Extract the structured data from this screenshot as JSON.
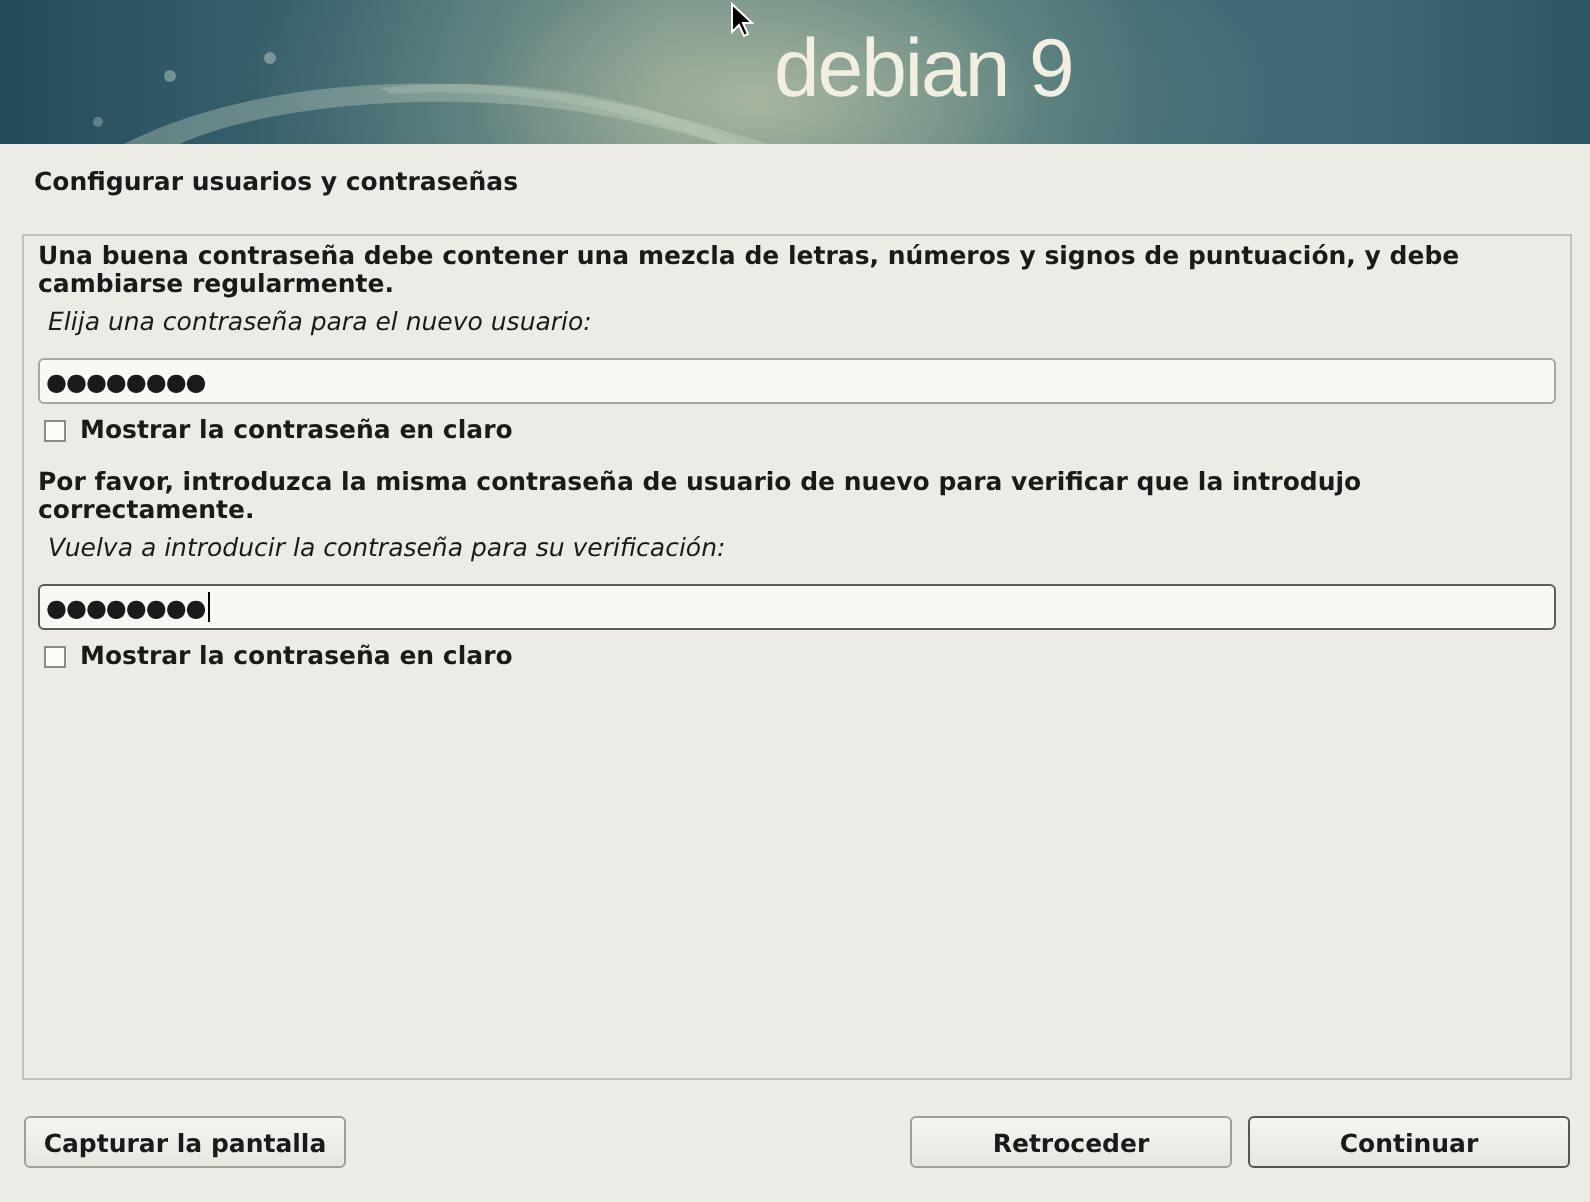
{
  "banner": {
    "logo": "debian 9"
  },
  "title": "Configurar usuarios y contraseñas",
  "sections": [
    {
      "description": "Una buena contraseña debe contener una mezcla de letras, números y signos de puntuación, y debe cambiarse regularmente.",
      "prompt": "Elija una contraseña para el nuevo usuario:",
      "password": {
        "masked_value": "●●●●●●●●",
        "focused": false
      },
      "show_password": {
        "label": "Mostrar la contraseña en claro",
        "checked": false
      }
    },
    {
      "description": "Por favor, introduzca la misma contraseña de usuario de nuevo para verificar que la introdujo correctamente.",
      "prompt": "Vuelva a introducir la contraseña para su verificación:",
      "password": {
        "masked_value": "●●●●●●●●",
        "focused": true
      },
      "show_password": {
        "label": "Mostrar la contraseña en claro",
        "checked": false
      }
    }
  ],
  "footer": {
    "secondary_buttons": [
      {
        "label": "Capturar la pantalla",
        "default": false
      }
    ],
    "navigation_buttons": [
      {
        "label": "Retroceder",
        "default": false
      },
      {
        "label": "Continuar",
        "default": true
      }
    ]
  }
}
